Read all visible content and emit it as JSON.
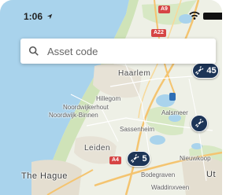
{
  "status_bar": {
    "time": "1:06"
  },
  "search": {
    "placeholder": "Asset code"
  },
  "map": {
    "places": {
      "haarlem": "Haarlem",
      "hillegom": "Hillegom",
      "noordwijkerhout": "Noordwijkerhout",
      "noordwijk_binnen": "Noordwijk-Binnen",
      "aalsmeer": "Aalsmeer",
      "sassenheim": "Sassenheim",
      "leiden": "Leiden",
      "nieuwkoop": "Nieuwkoop",
      "the_hague": "The Hague",
      "bodegraven": "Bodegraven",
      "waddinxveen": "Waddinxveen",
      "ut": "Ut"
    },
    "road_shields": {
      "a22": "A22",
      "a44": "A4",
      "a9": "A9"
    }
  },
  "markers": [
    {
      "kind": "cluster",
      "count": "45"
    },
    {
      "kind": "single"
    },
    {
      "kind": "cluster",
      "count": "5"
    }
  ],
  "colors": {
    "marker": "#1d3557",
    "water": "#a9d3ec",
    "land": "#eef0e6"
  }
}
